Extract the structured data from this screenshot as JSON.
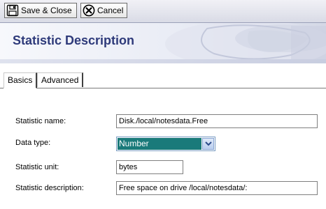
{
  "toolbar": {
    "save_label": "Save & Close",
    "cancel_label": "Cancel"
  },
  "header": {
    "title": "Statistic Description"
  },
  "tabs": [
    {
      "label": "Basics",
      "active": true
    },
    {
      "label": "Advanced",
      "active": false
    }
  ],
  "form": {
    "statistic_name": {
      "label": "Statistic name:",
      "value": "Disk./local/notesdata.Free"
    },
    "data_type": {
      "label": "Data type:",
      "value": "Number"
    },
    "statistic_unit": {
      "label": "Statistic unit:",
      "value": "bytes"
    },
    "statistic_description": {
      "label": "Statistic description:",
      "value": "Free space on drive /local/notesdata/:"
    }
  },
  "icons": {
    "save": "floppy-disk-icon",
    "cancel": "x-circle-icon",
    "dropdown": "chevron-down-icon"
  },
  "colors": {
    "title": "#2e3a7a",
    "selected_value_bg": "#1a7a7a"
  }
}
